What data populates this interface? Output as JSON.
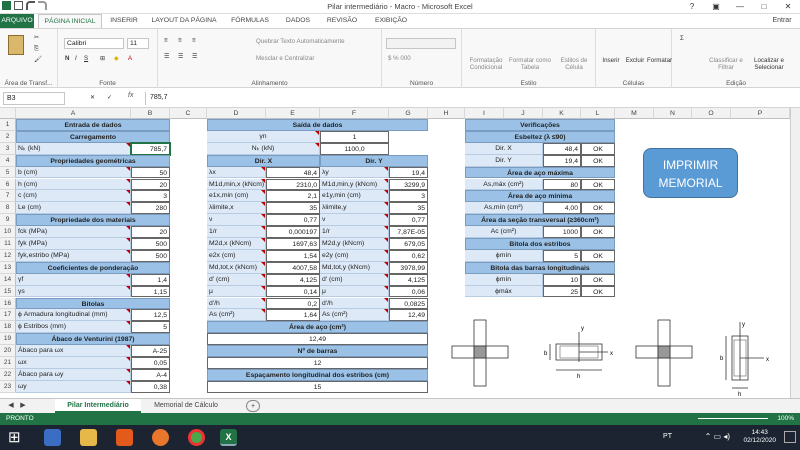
{
  "window": {
    "title": "Pilar intermediário - Macro - Microsoft Excel",
    "user": "Entrar"
  },
  "ribbon_tabs": [
    "ARQUIVO",
    "PÁGINA INICIAL",
    "INSERIR",
    "LAYOUT DA PÁGINA",
    "FÓRMULAS",
    "DADOS",
    "REVISÃO",
    "EXIBIÇÃO"
  ],
  "ribbon": {
    "clipboard_label": "Área de Transf...",
    "font_label": "Fonte",
    "font_name": "Calibri",
    "font_size": "11",
    "align_label": "Alinhamento",
    "wrap_text": "Quebrar Texto Automaticamente",
    "merge_center": "Mesclar e Centralizar",
    "number_label": "Número",
    "cond_format": "Formatação Condicional",
    "format_table": "Formatar como Tabela",
    "cell_styles": "Estilos de Célula",
    "style_label": "Estilo",
    "insert": "Inserir",
    "delete": "Excluir",
    "format": "Formatar",
    "cells_label": "Células",
    "sort_filter": "Classificar e Filtrar",
    "find_select": "Localizar e Selecionar",
    "edit_label": "Edição"
  },
  "formula_bar": {
    "name_box": "B3",
    "fx": "fx",
    "value": "785,7"
  },
  "columns": [
    "A",
    "B",
    "C",
    "D",
    "E",
    "F",
    "G",
    "H",
    "I",
    "J",
    "K",
    "L",
    "M",
    "N",
    "O",
    "P"
  ],
  "rows": [
    "1",
    "2",
    "3",
    "4",
    "5",
    "6",
    "7",
    "8",
    "9",
    "10",
    "11",
    "12",
    "13",
    "14",
    "15",
    "16",
    "17",
    "18",
    "19",
    "20",
    "21",
    "22",
    "23"
  ],
  "entrada": {
    "title": "Entrada de dados",
    "carregamento": "Carregamento",
    "nk_label": "Nₖ (kN)",
    "nk_value": "785,7",
    "prop_geo": "Propriedades geométricas",
    "b_label": "b (cm)",
    "b_value": "50",
    "h_label": "h (cm)",
    "h_value": "20",
    "c_label": "c (cm)",
    "c_value": "3",
    "le_label": "Le (cm)",
    "le_value": "280",
    "prop_mat": "Propriedade dos materiais",
    "fck_label": "fck (MPa)",
    "fck_value": "20",
    "fyk_label": "fyk (MPa)",
    "fyk_value": "500",
    "fyke_label": "fyk,estribo (MPa)",
    "fyke_value": "500",
    "coef": "Coeficientes de ponderação",
    "gf_label": "γf",
    "gf_value": "1,4",
    "gs_label": "γs",
    "gs_value": "1,15",
    "bitolas": "Bitolas",
    "phil_label": "ϕ Armadura longitudinal (mm)",
    "phil_value": "12,5",
    "phie_label": "ϕ Estribos (mm)",
    "phie_value": "5",
    "abaco": "Ábaco de Venturini (1987)",
    "abx_label": "Ábaco para ωx",
    "abx_value": "A-25",
    "wx_label": "ωx",
    "wx_value": "0,05",
    "aby_label": "Ábaco para ωy",
    "aby_value": "A-4",
    "wy_label": "ωy",
    "wy_value": "0,38"
  },
  "saida": {
    "title": "Saída de dados",
    "gn_label": "γn",
    "gn_value": "1",
    "nk_label": "Nₖ (kN)",
    "nk_value": "1100,0",
    "dirx": "Dir. X",
    "diry": "Dir. Y",
    "lx_label": "λx",
    "lx_value": "48,4",
    "ly_label": "λy",
    "ly_value": "19,4",
    "m1x_label": "M1d,min,x (kNcm)",
    "m1x_value": "2310,0",
    "m1y_label": "M1d,min,y (kNcm)",
    "m1y_value": "3299,9",
    "e1x_label": "e1x,min (cm)",
    "e1x_value": "2,1",
    "e1y_label": "e1y,min (cm)",
    "e1y_value": "3",
    "l1x_label": "λlimite,x",
    "l1x_value": "35",
    "l1y_label": "λlimite,y",
    "l1y_value": "35",
    "v_label": "ν",
    "v_value": "0,77",
    "v2_label": "ν",
    "v2_value": "0,77",
    "r1_label": "1/r",
    "r1_value": "0,000197",
    "r2_label": "1/r",
    "r2_value": "7,87E-05",
    "m2x_label": "M2d,x (kNcm)",
    "m2x_value": "1697,63",
    "m2y_label": "M2d,y (kNcm)",
    "m2y_value": "679,05",
    "e2x_label": "e2x (cm)",
    "e2x_value": "1,54",
    "e2y_label": "e2y (cm)",
    "e2y_value": "0,62",
    "mtx_label": "Md,tot,x (kNcm)",
    "mtx_value": "4007,58",
    "mty_label": "Md,tot,y (kNcm)",
    "mty_value": "3978,99",
    "d1_label": "d' (cm)",
    "d1_value": "4,125",
    "d2_label": "d' (cm)",
    "d2_value": "4,125",
    "mu1_label": "μ",
    "mu1_value": "0,14",
    "mu2_label": "μ",
    "mu2_value": "0,06",
    "dh1_label": "d'/h",
    "dh1_value": "0,2",
    "dh2_label": "d'/h",
    "dh2_value": "0,0825",
    "as1_label": "As (cm²)",
    "as1_value": "1,64",
    "as2_label": "As (cm²)",
    "as2_value": "12,49",
    "area_aco": "Área de aço (cm²)",
    "area_aco_value": "12,49",
    "nbarras": "Nº de barras",
    "nbarras_value": "12",
    "espac": "Espaçamento longitudinal dos estribos (cm)",
    "espac_value": "15"
  },
  "verif": {
    "title": "Verificações",
    "esbeltez": "Esbeltez (λ ≤90)",
    "dx_label": "Dir. X",
    "dx_value": "48,4",
    "dx_ok": "OK",
    "dy_label": "Dir. Y",
    "dy_value": "19,4",
    "dy_ok": "OK",
    "amax": "Área de aço máxima",
    "asmax_label": "As,máx (cm²)",
    "asmax_value": "80",
    "asmax_ok": "OK",
    "amin": "Área de aço mínima",
    "asmin_label": "As,mín (cm²)",
    "asmin_value": "4,00",
    "asmin_ok": "OK",
    "secao": "Área da seção transversal (≥360cm²)",
    "ac_label": "Ac (cm²)",
    "ac_value": "1000",
    "ac_ok": "OK",
    "bit_est": "Bitola dos estribos",
    "phimin_label": "ϕmín",
    "phimin_value": "5",
    "phimin_ok": "OK",
    "bit_long": "Bitola das barras longitudinais",
    "pmin_label": "ϕmín",
    "pmin_value": "10",
    "pmin_ok": "OK",
    "pmax_label": "ϕmáx",
    "pmax_value": "25",
    "pmax_ok": "OK"
  },
  "button": {
    "label": "IMPRIMIR MEMORIAL"
  },
  "sheets": [
    "Pilar Intermediário",
    "Memorial de Cálculo"
  ],
  "status": {
    "ready": "PRONTO",
    "zoom": "100%"
  },
  "taskbar": {
    "lang": "PT",
    "time": "14:43",
    "date": "02/12/2020"
  },
  "diagram_labels": {
    "b": "b",
    "h": "h",
    "x": "x",
    "y": "y",
    "a": "a"
  }
}
